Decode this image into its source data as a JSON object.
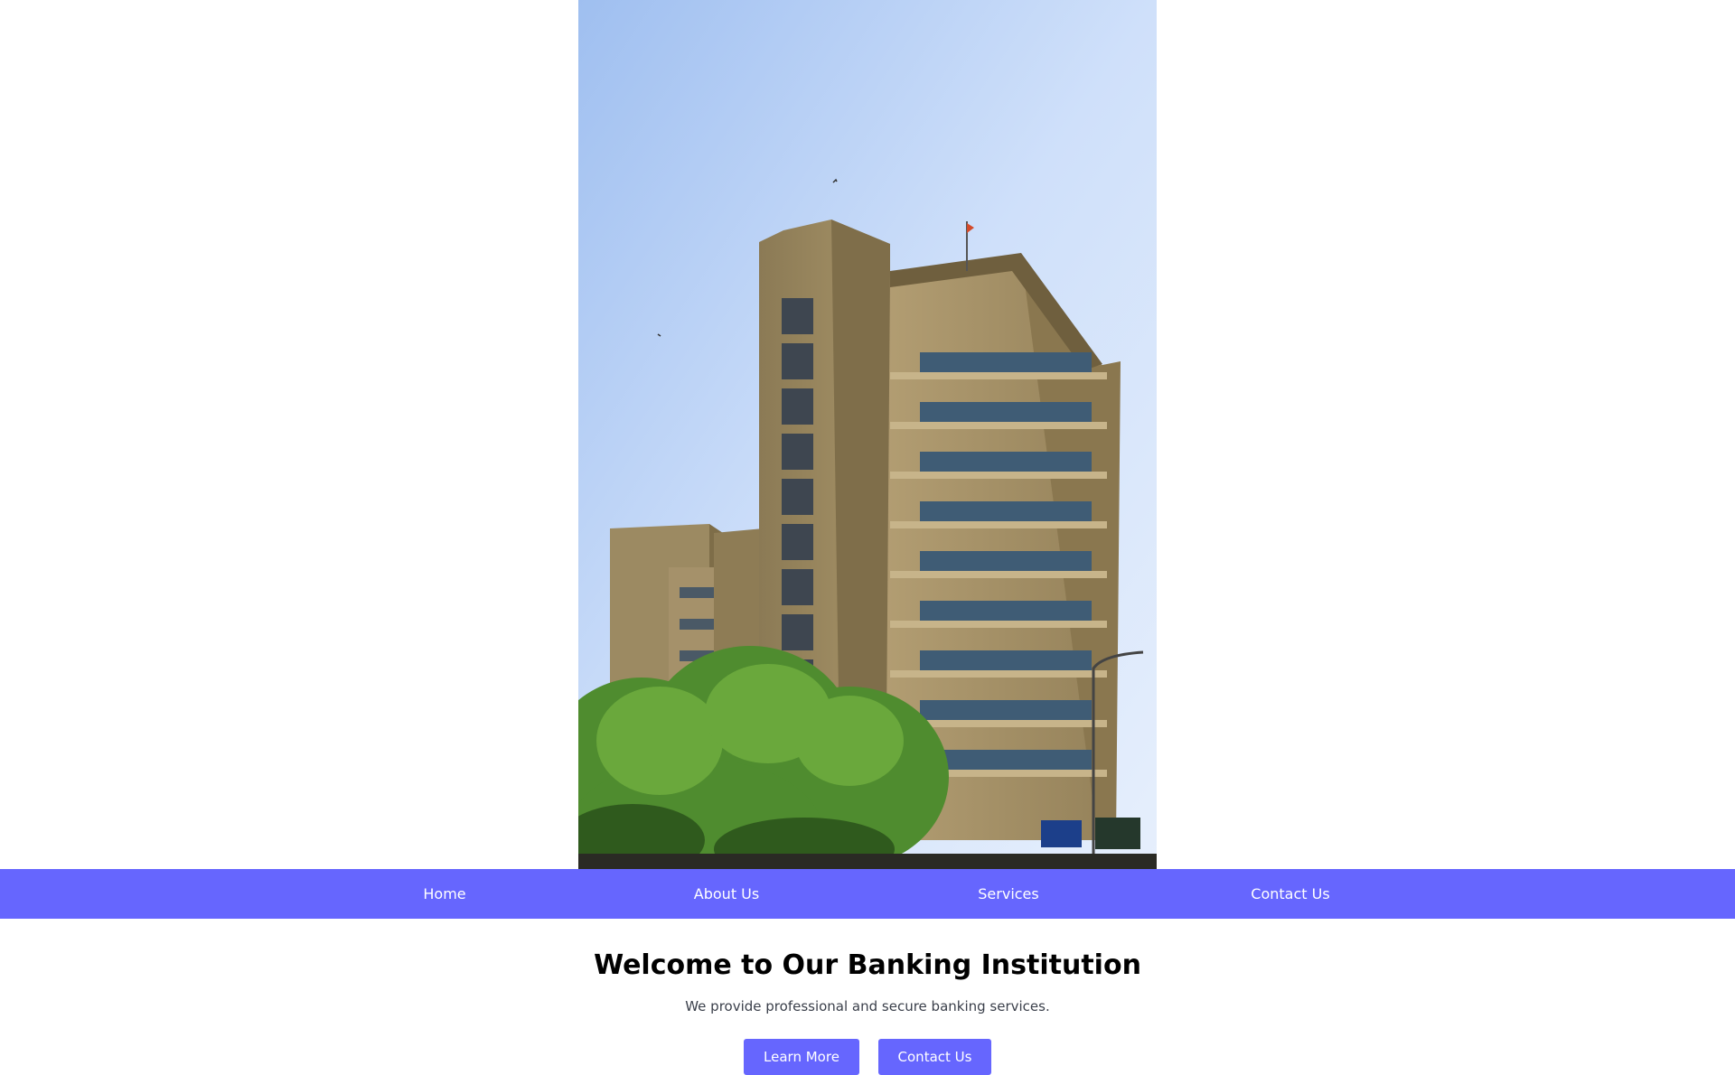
{
  "hero": {
    "image_alt": "Tall concrete bank building with trees against a blue sky"
  },
  "nav": {
    "items": [
      {
        "label": "Home"
      },
      {
        "label": "About Us"
      },
      {
        "label": "Services"
      },
      {
        "label": "Contact Us"
      }
    ]
  },
  "main": {
    "title": "Welcome to Our Banking Institution",
    "subtitle": "We provide professional and secure banking services.",
    "buttons": [
      {
        "label": "Learn More"
      },
      {
        "label": "Contact Us"
      }
    ]
  },
  "colors": {
    "accent": "#6666fe",
    "text": "#000000",
    "muted": "#3a3f4a",
    "background": "#ffffff"
  }
}
